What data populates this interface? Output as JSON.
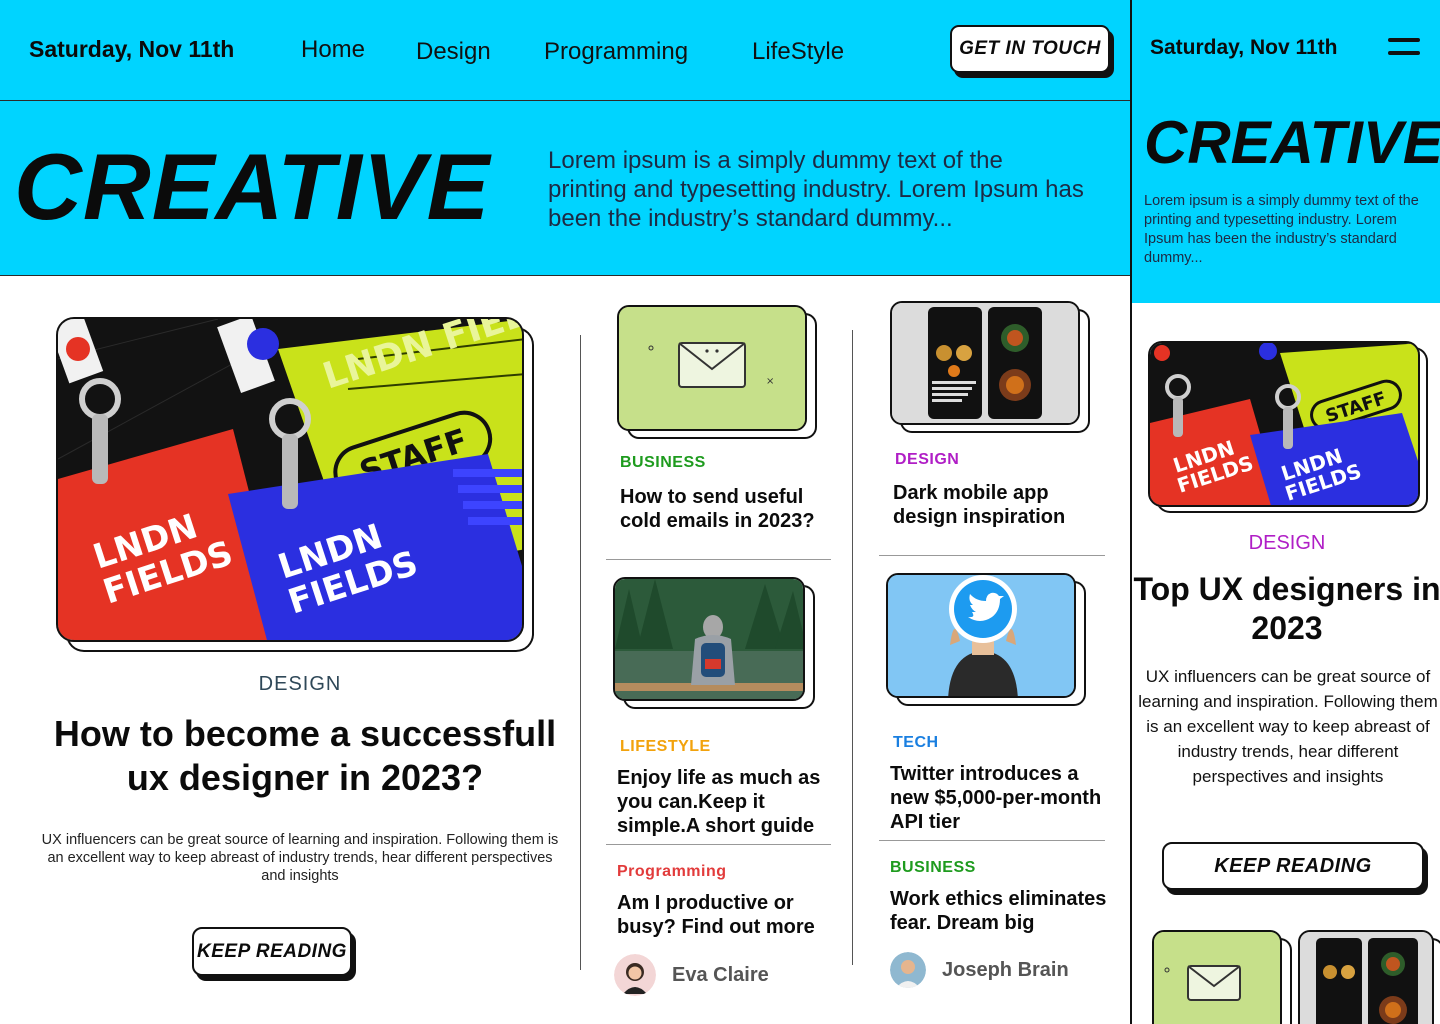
{
  "header": {
    "date": "Saturday, Nov 11th",
    "nav": [
      "Home",
      "Design",
      "Programming",
      "LifeStyle"
    ],
    "cta": "GET IN TOUCH"
  },
  "hero": {
    "title": "CREATIVE",
    "text": "Lorem ipsum is a simply dummy text of the printing and typesetting industry. Lorem Ipsum has been the industry’s standard dummy..."
  },
  "featured": {
    "category": "DESIGN",
    "title": "How to become a successfull ux designer in 2023?",
    "description": "UX influencers can be great source of learning and inspiration. Following them is an excellent way to keep abreast of industry trends, hear different perspectives and insights",
    "button": "KEEP READING"
  },
  "posts": [
    {
      "category": "BUSINESS",
      "title": "How to send useful cold emails in 2023?",
      "color": "#1e9b1e"
    },
    {
      "category": "DESIGN",
      "title": "Dark mobile app design inspiration",
      "color": "#b01ec6"
    },
    {
      "category": "LIFESTYLE",
      "title": "Enjoy life as much as you can.Keep it simple.A short guide",
      "color": "#f2a20c"
    },
    {
      "category": "TECH",
      "title": "Twitter introduces a new $5,000-per-month API tier",
      "color": "#1a7fe0"
    },
    {
      "category": "Programming",
      "title": "Am I productive or busy? Find out more",
      "color": "#e23b3b"
    },
    {
      "category": "BUSINESS",
      "title": "Work ethics eliminates fear. Dream big",
      "color": "#1e9b1e"
    }
  ],
  "authors": [
    "Eva Claire",
    "Joseph Brain"
  ],
  "mobile": {
    "date": "Saturday, Nov 11th",
    "title": "CREATIVE",
    "text": "Lorem ipsum is a simply dummy text of the printing and typesetting industry. Lorem Ipsum has been the industry’s standard dummy...",
    "category": "DESIGN",
    "headline": "Top UX designers in 2023",
    "description": "UX influencers can be great source of learning and inspiration. Following them is an excellent way to keep abreast of industry trends, hear different perspectives and insights",
    "button": "KEEP READING"
  },
  "colors": {
    "accent": "#00d4ff",
    "ink": "#111111"
  },
  "icons": [
    "menu-icon",
    "envelope-icon",
    "twitter-icon"
  ]
}
